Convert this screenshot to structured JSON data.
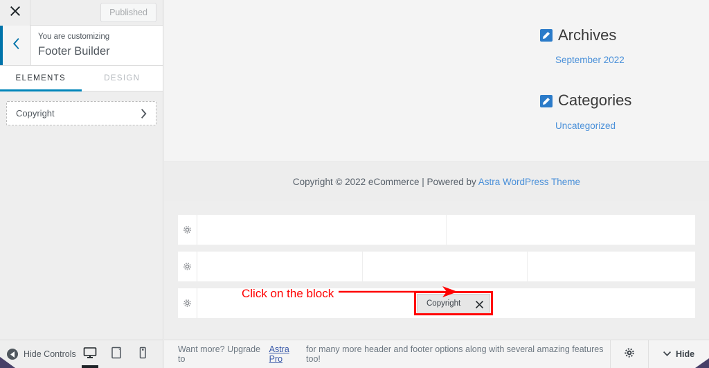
{
  "customizer": {
    "close_icon": "close-icon",
    "publish_button": "Published",
    "back_icon": "chevron-left-icon",
    "header_subtitle": "You are customizing",
    "header_title": "Footer Builder",
    "tabs": [
      {
        "label": "ELEMENTS",
        "active": true
      },
      {
        "label": "DESIGN",
        "active": false
      }
    ],
    "elements": [
      {
        "label": "Copyright",
        "chevron": "chevron-right-icon"
      }
    ],
    "footer_toolbar": {
      "hide_controls_label": "Hide Controls",
      "hide_controls_icon": "collapse-left-icon",
      "devices": [
        {
          "name": "desktop",
          "icon": "desktop-icon",
          "active": true
        },
        {
          "name": "tablet",
          "icon": "tablet-icon",
          "active": false
        },
        {
          "name": "mobile",
          "icon": "mobile-icon",
          "active": false
        }
      ]
    },
    "accent_color": "#0085ba"
  },
  "preview": {
    "widgets": [
      {
        "edit_icon": "pencil-edit-icon",
        "title": "Archives",
        "links": [
          "September 2022"
        ]
      },
      {
        "edit_icon": "pencil-edit-icon",
        "title": "Categories",
        "links": [
          "Uncategorized"
        ]
      }
    ],
    "copyright_bar": {
      "prefix": "Copyright © 2022 eCommerce | Powered by ",
      "link": "Astra WordPress Theme"
    },
    "link_color": "#4a90d9"
  },
  "footer_builder": {
    "gear_icon": "gear-icon",
    "rows": [
      {
        "name": "above-footer-row",
        "columns": 2
      },
      {
        "name": "primary-footer-row",
        "columns": 3
      },
      {
        "name": "below-footer-row",
        "columns": 1
      }
    ],
    "block": {
      "label": "Copyright",
      "remove_icon": "close-icon",
      "highlight_color": "#ff0000"
    },
    "annotation": {
      "text": "Click on the block",
      "arrow_icon": "arrow-right-icon",
      "color": "#ff0000"
    }
  },
  "astra_bar": {
    "message_prefix": "Want more? Upgrade to ",
    "message_link": "Astra Pro",
    "message_suffix": " for many more header and footer options along with several amazing features too!",
    "gear_icon": "gear-icon",
    "hide_icon": "chevron-down-icon",
    "hide_label": "Hide"
  }
}
